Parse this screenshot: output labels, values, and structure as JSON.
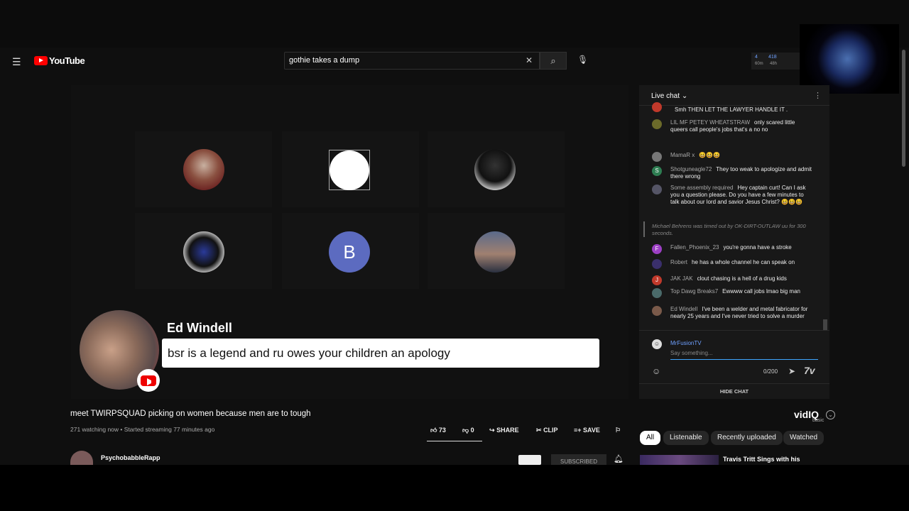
{
  "header": {
    "logo": "YouTube",
    "search_value": "gothie takes a dump",
    "stats": {
      "a": "4",
      "a_sub": "60m",
      "b": "418",
      "b_sub": "48h"
    }
  },
  "overlay": {
    "name": "Ed Windell",
    "comment": "bsr is a legend and ru owes your children an apology",
    "tile_b_letter": "B"
  },
  "chat": {
    "title": "Live chat",
    "messages": [
      {
        "author": "",
        "text": "Smh THEN LET THE LAWYER HANDLE IT .",
        "color": "#c0392b"
      },
      {
        "author": "LIL MF PETEY WHEATSTRAW",
        "text": "only scared little queers call people's jobs that's a no no",
        "color": "#6b6a2a"
      },
      {
        "author": "MamaR x",
        "text": "😆😆😆",
        "color": "#777"
      },
      {
        "author": "Shotguneagle72",
        "text": "They too weak to apologize and admit there wrong",
        "initial": "S",
        "color": "#2e7d52"
      },
      {
        "author": "Some assembly required",
        "text": "Hey captain curt! Can I ask you a question please. Do you have a few minutes to talk about our lord and savior Jesus Christ? 😆😆😆",
        "color": "#556"
      },
      {
        "author": "Fallen_Phoenix_23",
        "text": "you're gonna have a stroke",
        "initial": "F",
        "color": "#9c3fc4"
      },
      {
        "author": "Robert",
        "text": "he has a whole channel he can speak on",
        "color": "#3a2f6b"
      },
      {
        "author": "JAK JAK",
        "text": "clout chasing is a hell of a drug kids",
        "initial": "J",
        "color": "#c0392b"
      },
      {
        "author": "Top Dawg Breaks7",
        "text": "Ewwww call jobs lmao big man",
        "color": "#4a6a6a"
      },
      {
        "author": "Ed Windell",
        "text": "I've been a welder and metal fabricator for nearly 25 years and I've never tried to solve a murder",
        "color": "#7a5a4a"
      }
    ],
    "timeout": "Michael Behrens was timed out by OK-DIRT-OUTLAW uu for 300 seconds.",
    "user": "MrFusionTV",
    "placeholder": "Say something...",
    "counter": "0/200",
    "hide": "HIDE CHAT"
  },
  "video": {
    "title": "meet TWIRPSQUAD picking on women because men are to tough",
    "meta": "271 watching now • Started streaming 77 minutes ago",
    "likes": "73",
    "dislikes": "0",
    "share": "SHARE",
    "clip": "CLIP",
    "save": "SAVE",
    "channel": "PsychobabbleRapp",
    "subscribed": "SUBSCRIBED"
  },
  "vidiq": {
    "logo": "vidIQ",
    "tier": "basic"
  },
  "chips": [
    "All",
    "Listenable",
    "Recently uploaded",
    "Watched"
  ],
  "related": {
    "title": "Travis Tritt Sings with his"
  }
}
